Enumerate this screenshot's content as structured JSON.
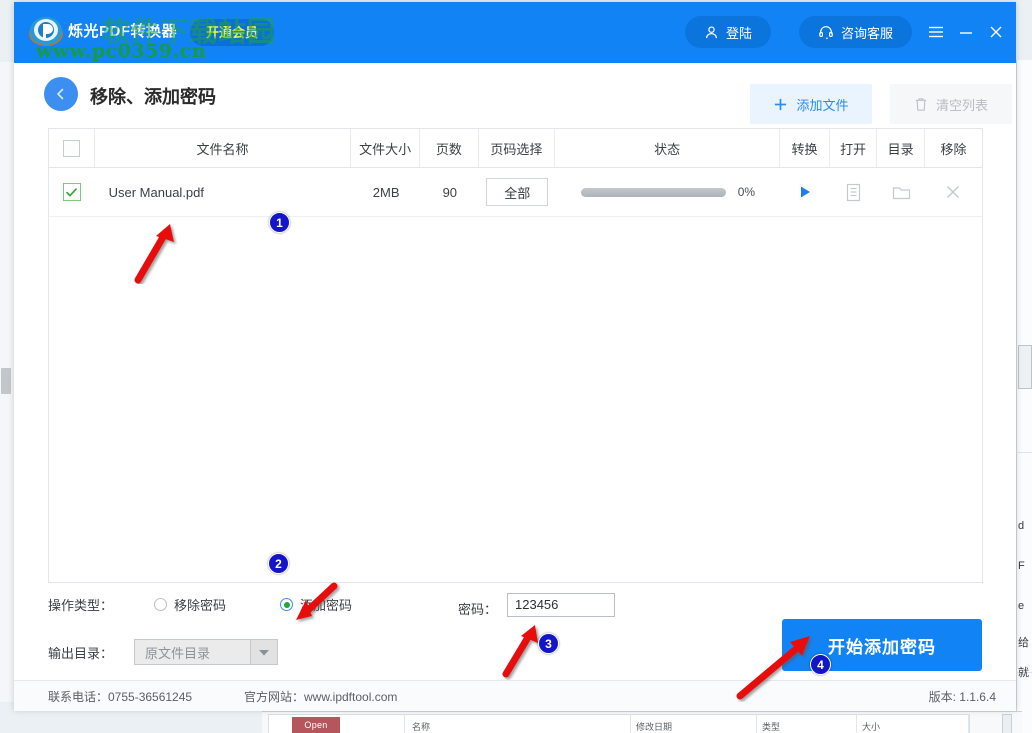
{
  "window": {
    "title": "烁光PDF转换器",
    "vip_button": "开通会员",
    "login_button": "登陆",
    "service_button": "咨询客服",
    "accent_color": "#1283f5",
    "menu_icon": "hamburger-menu-icon",
    "minimize_icon": "minimize-icon",
    "close_icon": "close-icon"
  },
  "watermark": {
    "text_cn": "软件下载站园",
    "url": "www.pc0359.cn",
    "color": "#169b45"
  },
  "page": {
    "title": "移除、添加密码",
    "back_icon": "back-arrow-icon",
    "add_file_button": "添加文件",
    "add_file_icon": "plus-icon",
    "clear_list_button": "清空列表",
    "clear_list_icon": "trash-icon"
  },
  "table": {
    "headers": {
      "checkbox": "",
      "name": "文件名称",
      "size": "文件大小",
      "pages": "页数",
      "page_select": "页码选择",
      "status": "状态",
      "convert": "转换",
      "open": "打开",
      "directory": "目录",
      "remove": "移除"
    },
    "rows": [
      {
        "checked": true,
        "name": "User Manual.pdf",
        "size": "2MB",
        "pages": "90",
        "page_select": "全部",
        "progress": 0,
        "progress_text": "0%",
        "convert_icon": "play-icon",
        "open_icon": "document-icon",
        "directory_icon": "folder-icon",
        "remove_icon": "close-x-icon"
      }
    ]
  },
  "options": {
    "operation_label": "操作类型：",
    "radio_remove": "移除密码",
    "radio_add": "添加密码",
    "selected_radio": "添加密码",
    "output_label": "输出目录：",
    "output_value": "原文件目录",
    "password_label": "密码：",
    "password_value": "123456",
    "start_button": "开始添加密码"
  },
  "footer": {
    "phone": "联系电话：0755-36561245",
    "website": "官方网站：www.ipdftool.com",
    "version": "版本: 1.1.6.4"
  },
  "annotations": {
    "markers": [
      "1",
      "2",
      "3",
      "4"
    ]
  },
  "background_dialog": {
    "open_button": "Open",
    "col_name": "名称",
    "col_date": "修改日期",
    "col_type": "类型",
    "col_size": "大小"
  },
  "background_right": {
    "line1": "d",
    "line2": "F",
    "line3": "e",
    "line4": "给",
    "line5": "就"
  }
}
